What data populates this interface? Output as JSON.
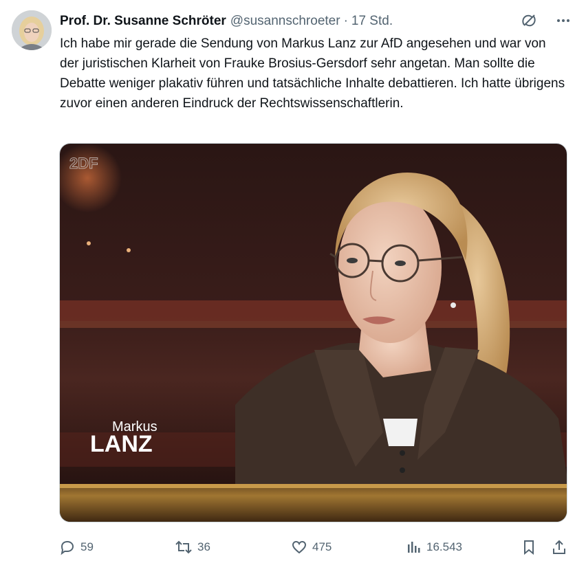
{
  "tweet": {
    "author_name": "Prof. Dr. Susanne Schröter",
    "handle": "@susannschroeter",
    "separator": "·",
    "time": "17 Std.",
    "text": "Ich habe mir gerade die Sendung von Markus Lanz zur AfD angesehen und war von der juristischen Klarheit von Frauke Brosius-Gersdorf sehr angetan. Man sollte die Debatte weniger plakativ führen und tatsächliche Inhalte debattieren. Ich hatte übrigens zuvor einen anderen Eindruck der Rechtswissenschaftlerin.",
    "media": {
      "show_name_top": "Markus",
      "show_name_bottom": "LANZ",
      "channel_logo": "2DF"
    }
  },
  "top_icons": [
    "grok-icon",
    "more-icon"
  ],
  "actions": {
    "replies": "59",
    "retweets": "36",
    "likes": "475",
    "views": "16.543"
  },
  "colors": {
    "text": "#0f1419",
    "secondary": "#536471",
    "border": "#cfd9de"
  }
}
